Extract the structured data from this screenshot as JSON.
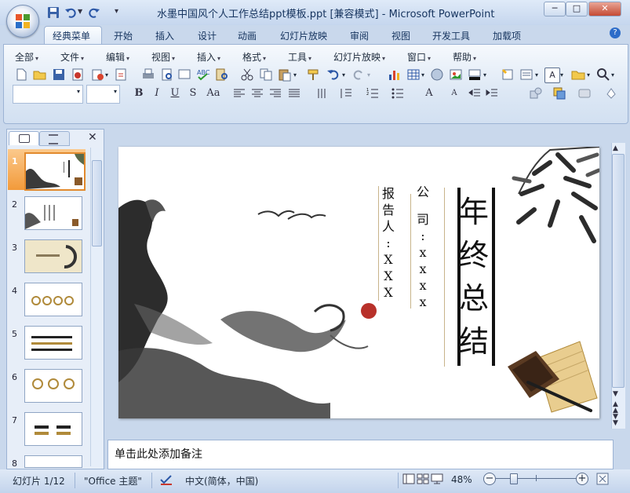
{
  "window": {
    "title": "水墨中国风个人工作总结ppt模板.ppt [兼容模式] - Microsoft PowerPoint",
    "minimize": "─",
    "maximize": "□",
    "close": "✕"
  },
  "ribbon_tabs": [
    "经典菜单",
    "开始",
    "插入",
    "设计",
    "动画",
    "幻灯片放映",
    "审阅",
    "视图",
    "开发工具",
    "加载项"
  ],
  "menus": [
    "全部",
    "文件",
    "编辑",
    "视图",
    "插入",
    "格式",
    "工具",
    "幻灯片放映",
    "窗口",
    "帮助"
  ],
  "format_buttons": {
    "bold": "B",
    "italic": "I",
    "underline": "U",
    "shadow": "S",
    "case": "Aa"
  },
  "thumbnails": [
    "1",
    "2",
    "3",
    "4",
    "5",
    "6",
    "7",
    "8"
  ],
  "slide": {
    "main_title": [
      "年",
      "终",
      "总",
      "结"
    ],
    "company_label": [
      "公",
      "司",
      ":"
    ],
    "company_value": [
      "x",
      "x",
      "x",
      "x"
    ],
    "reporter_label": [
      "报",
      "告",
      "人",
      ":"
    ],
    "reporter_value": [
      "X",
      "X",
      "X"
    ]
  },
  "notes_placeholder": "单击此处添加备注",
  "status": {
    "slide_info": "幻灯片 1/12",
    "theme": "\"Office 主题\"",
    "language": "中文(简体，中国)",
    "zoom": "48%",
    "zoom_level": 0.48
  },
  "colors": {
    "accent": "#e28a2e",
    "ribbon_text": "#15335e"
  }
}
